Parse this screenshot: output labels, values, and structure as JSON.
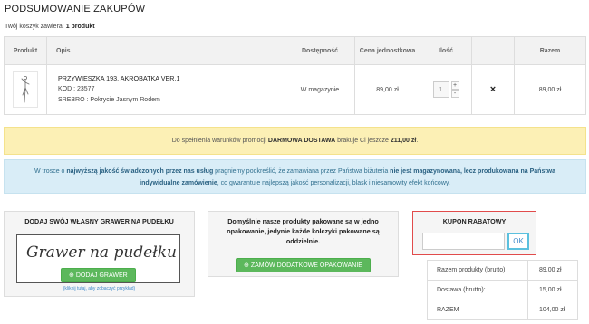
{
  "page": {
    "title": "PODSUMOWANIE ZAKUPÓW",
    "cart_info_prefix": "Twój koszyk zawiera: ",
    "cart_info_count": "1 produkt"
  },
  "cart": {
    "headers": [
      "Produkt",
      "Opis",
      "Dostępność",
      "Cena jednostkowa",
      "Ilość",
      "",
      "Razem"
    ],
    "items": [
      {
        "name": "PRZYWIESZKA 193, AKROBATKA VER.1",
        "code": "KOD : 23577",
        "variant": "SREBRO : Pokrycie Jasnym Rodem",
        "availability": "W magazynie",
        "unit_price": "89,00 zł",
        "quantity": "1",
        "qty_up": "+",
        "qty_down": "-",
        "remove": "×",
        "total": "89,00 zł"
      }
    ]
  },
  "promo": {
    "prefix": "Do spełnienia warunków promocji ",
    "promo_name": "DARMOWA DOSTAWA",
    "middle": " brakuje Ci jeszcze ",
    "amount": "211,00 zł",
    "suffix": "."
  },
  "info": {
    "t1": "W trosce o ",
    "b1": "najwyższą jakość świadczonych przez nas usług",
    "t2": " pragniemy podkreślić, że zamawiana przez Państwa biżuteria ",
    "b2": "nie jest magazynowana, lecz produkowana na Państwa indywidualne zamówienie",
    "t3": ", co gwarantuje najlepszą jakość personalizacji, blask i niesamowity efekt końcowy."
  },
  "engrave": {
    "title": "DODAJ SWÓJ WŁASNY GRAWER NA PUDEŁKU",
    "sample_text": "Grawer na pudełku",
    "button": "DODAJ GRAWER",
    "note": "(kliknij tutaj, aby zobaczyć przykład)"
  },
  "packaging": {
    "text": "Domyślnie nasze produkty pakowane są w jedno opakowanie, jedynie każde kolczyki pakowane są oddzielnie.",
    "button": "ZAMÓW DODATKOWE OPAKOWANIE"
  },
  "coupon": {
    "title": "KUPON RABATOWY",
    "input_value": "",
    "ok": "OK"
  },
  "totals": [
    {
      "label": "Razem produkty (brutto)",
      "value": "89,00 zł"
    },
    {
      "label": "Dostawa (brutto):",
      "value": "15,00 zł"
    },
    {
      "label": "RAZEM",
      "value": "104,00 zł"
    }
  ],
  "colors": {
    "promo_bg": "#fcf0b5",
    "info_bg": "#d9edf7",
    "button_green": "#5cb85c",
    "coupon_border": "#e14b4b"
  }
}
